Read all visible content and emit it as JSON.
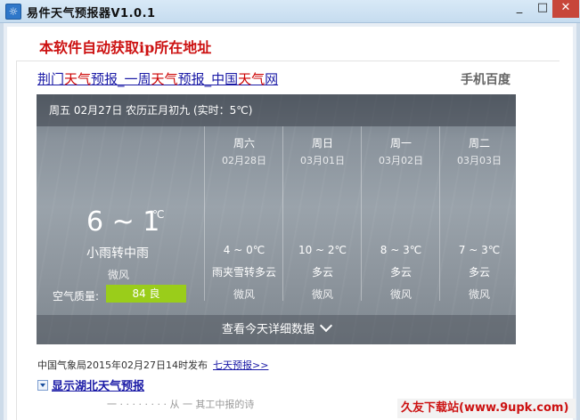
{
  "window": {
    "title": "易件天气预报器V1.0.1",
    "min": "_",
    "max": "□",
    "close": "✕"
  },
  "notice": "本软件自动获取ip所在地址",
  "links": {
    "part1": "荆门",
    "part2": "天气",
    "part3": "预报_一周",
    "part4": "天气",
    "part5": "预报_中国",
    "part6": "天气",
    "part7": "网",
    "right": "手机百度"
  },
  "weather": {
    "header": "周五 02月27日 农历正月初九 (实时：5℃)",
    "today": {
      "temp": "6 ~ 1",
      "unit": "℃",
      "condition": "小雨转中雨",
      "wind": "微风",
      "aq_label": "空气质量:",
      "aq_value": "84 良"
    },
    "days": [
      {
        "weekday": "周六",
        "date": "02月28日",
        "temp": "4 ~ 0℃",
        "condition": "雨夹雪转多云",
        "wind": "微风"
      },
      {
        "weekday": "周日",
        "date": "03月01日",
        "temp": "10 ~ 2℃",
        "condition": "多云",
        "wind": "微风"
      },
      {
        "weekday": "周一",
        "date": "03月02日",
        "temp": "8 ~ 3℃",
        "condition": "多云",
        "wind": "微风"
      },
      {
        "weekday": "周二",
        "date": "03月03日",
        "temp": "7 ~ 3℃",
        "condition": "多云",
        "wind": "微风"
      }
    ],
    "details_label": "查看今天详细数据"
  },
  "publish": {
    "text": "中国气象局2015年02月27日14时发布",
    "link": "七天预报>>"
  },
  "toggle_label": "显示湖北天气预报",
  "cutoff_text": "一 · · · · · · · · 从  一  其工中报的诗",
  "watermark": "久友下载站(www.9upk.com)",
  "colors": {
    "accent_red": "#cc1111",
    "link_blue": "#1a1aa6",
    "aq_green": "#9acd1a",
    "close_red": "#c7463a"
  }
}
